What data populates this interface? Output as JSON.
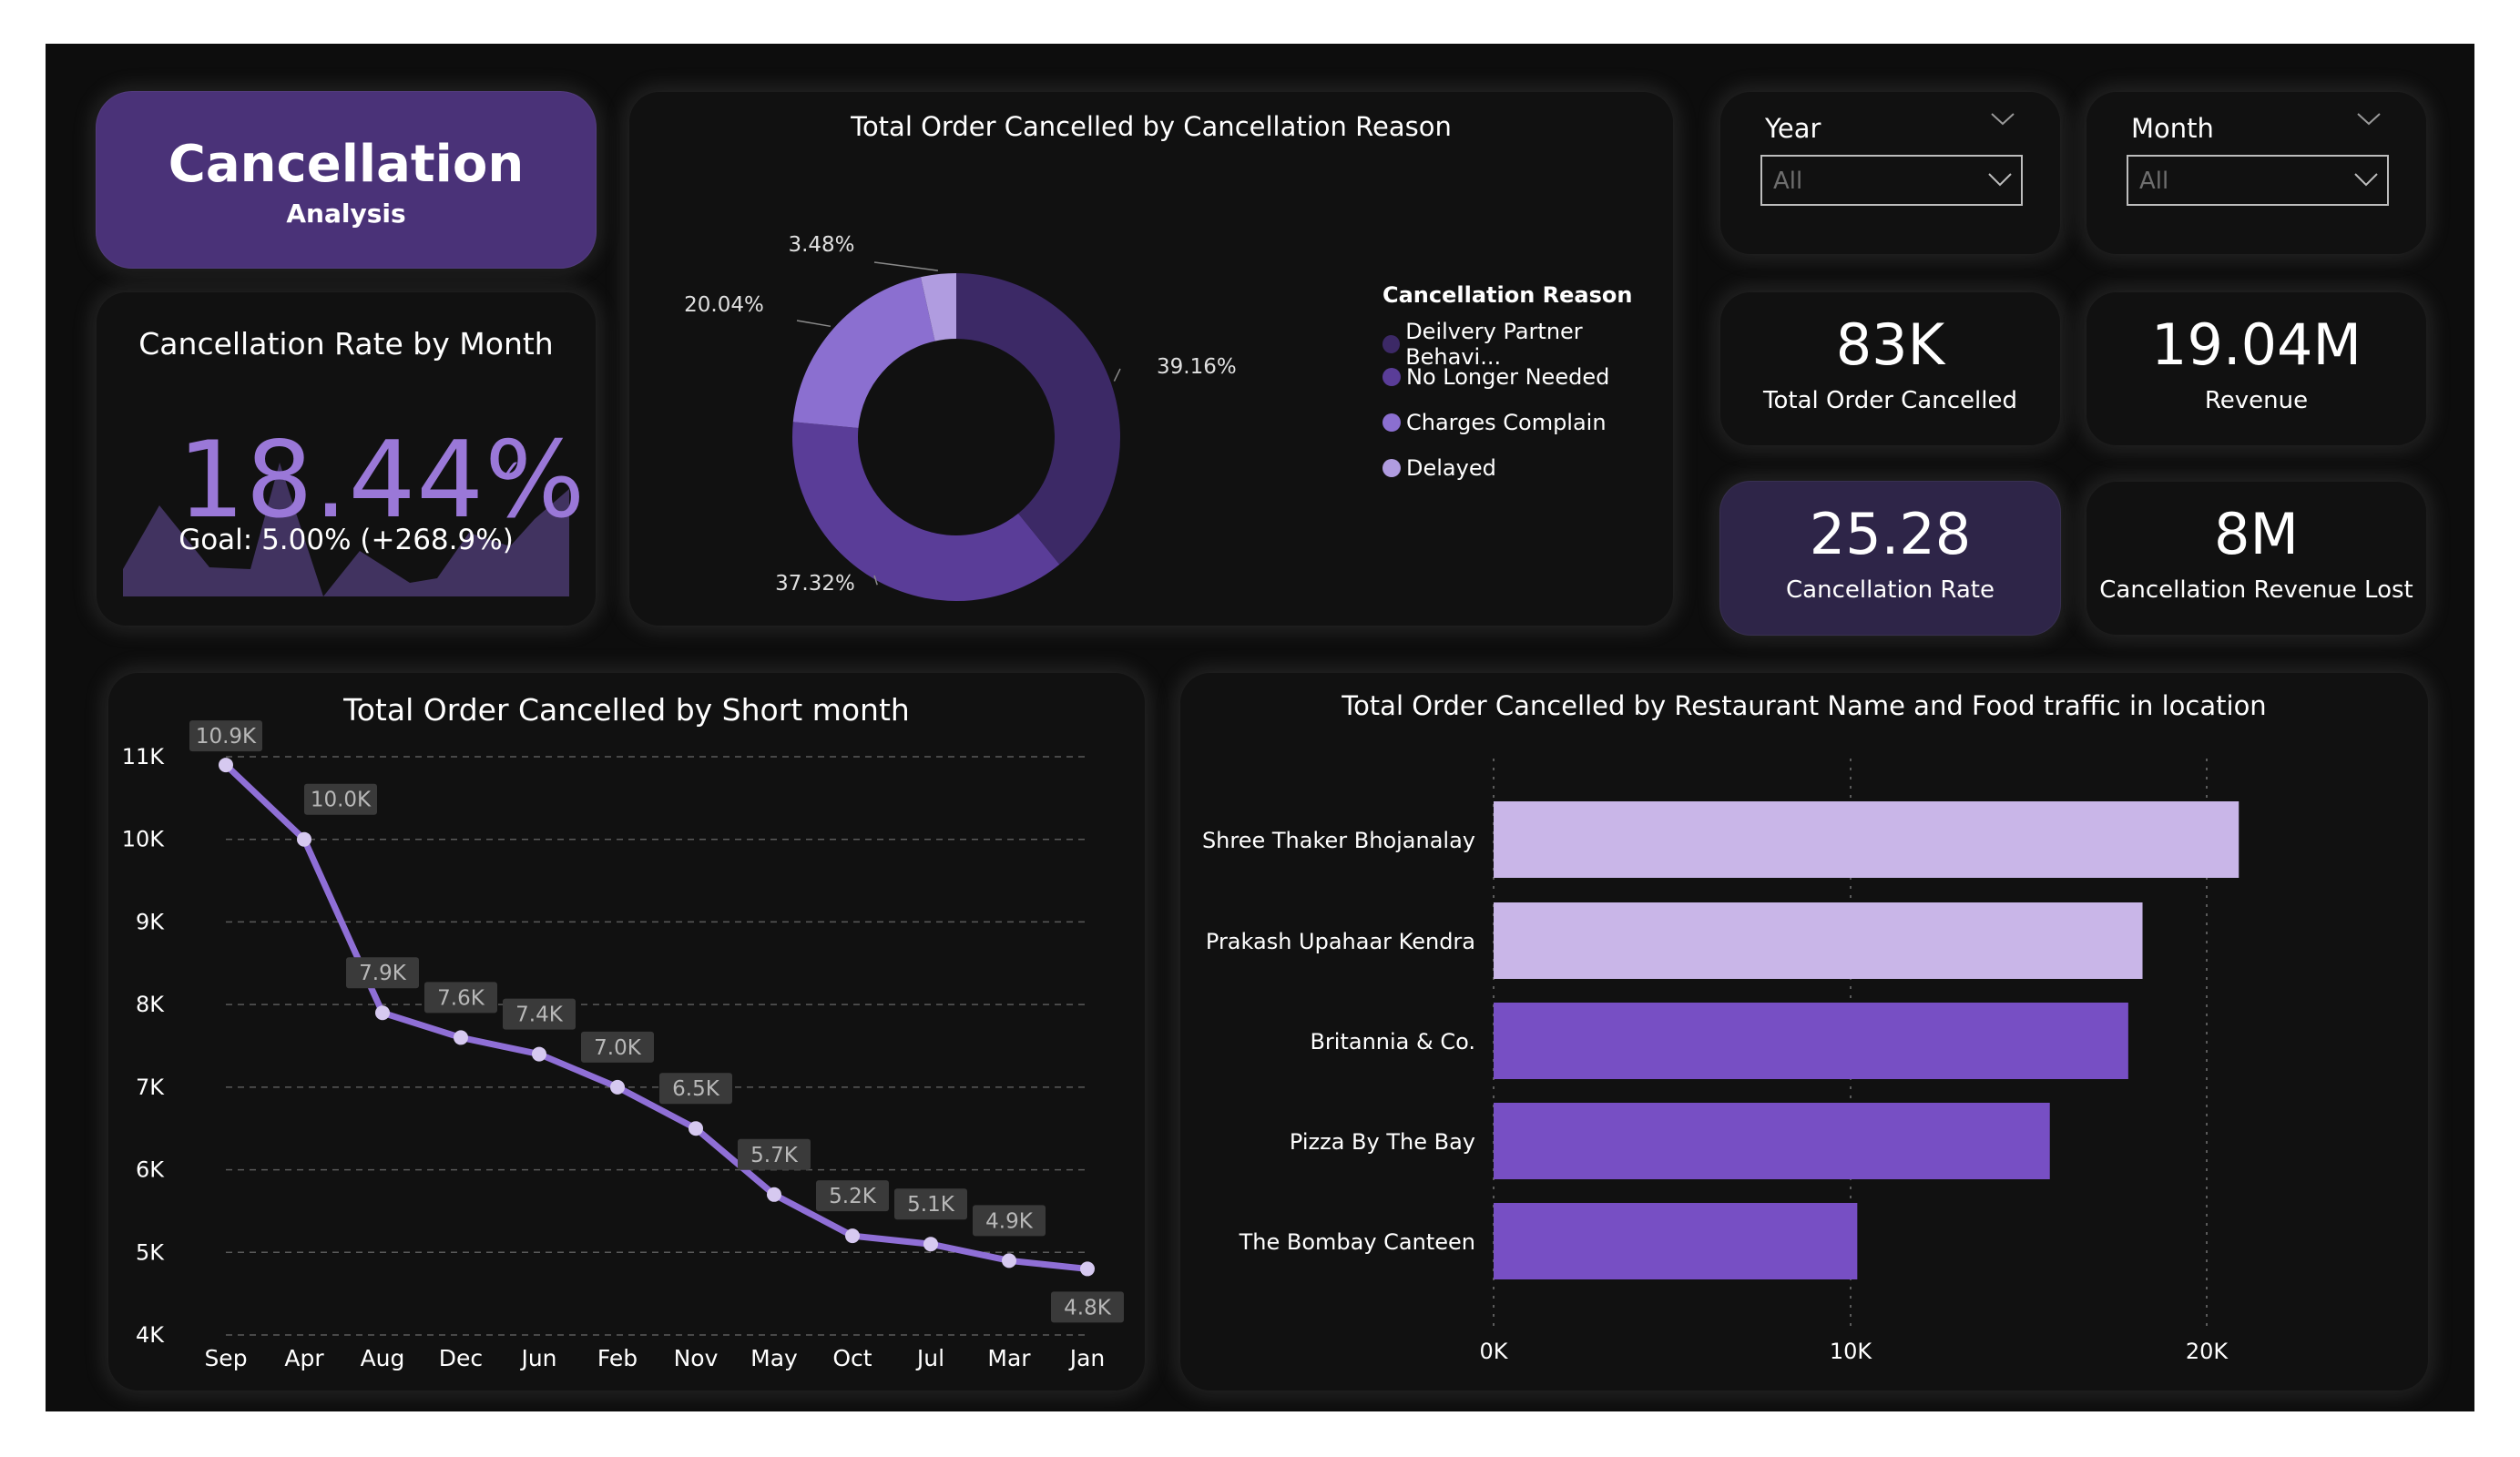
{
  "header": {
    "title": "Cancellation",
    "subtitle": "Analysis"
  },
  "rate_card": {
    "title": "Cancellation Rate by Month",
    "value": "18.44%",
    "goal": "Goal: 5.00% (+268.9%)"
  },
  "slicers": {
    "year": {
      "label": "Year",
      "value": "All"
    },
    "month": {
      "label": "Month",
      "value": "All"
    }
  },
  "kpis": {
    "total_orders": {
      "value": "83K",
      "label": "Total Order Cancelled"
    },
    "revenue": {
      "value": "19.04M",
      "label": "Revenue"
    },
    "cancellation_rate": {
      "value": "25.28",
      "label": "Cancellation Rate"
    },
    "revenue_lost": {
      "value": "8M",
      "label": "Cancellation Revenue Lost"
    }
  },
  "colors": {
    "accent": "#8b6fd0",
    "title_card": "#4a3278",
    "donut": [
      "#3c2966",
      "#5a3d98",
      "#8b6fd0",
      "#b09ce0"
    ],
    "bar_light": "#c9b6e8",
    "bar_dark": "#774fc4"
  },
  "chart_data": [
    {
      "type": "pie",
      "title": "Total Order Cancelled by Cancellation Reason",
      "legend_title": "Cancellation Reason",
      "legend_position": "right",
      "categories": [
        "Deilvery Partner Behavi...",
        "No Longer Needed",
        "Charges Complain",
        "Delayed"
      ],
      "values": [
        39.16,
        37.32,
        20.04,
        3.48
      ],
      "labels": [
        "39.16%",
        "37.32%",
        "20.04%",
        "3.48%"
      ]
    },
    {
      "type": "line",
      "title": "Total Order Cancelled by Short month",
      "categories": [
        "Sep",
        "Apr",
        "Aug",
        "Dec",
        "Jun",
        "Feb",
        "Nov",
        "May",
        "Oct",
        "Jul",
        "Mar",
        "Jan"
      ],
      "values": [
        10.9,
        10.0,
        7.9,
        7.6,
        7.4,
        7.0,
        6.5,
        5.7,
        5.2,
        5.1,
        4.9,
        4.8
      ],
      "data_labels": [
        "10.9K",
        "10.0K",
        "7.9K",
        "7.6K",
        "7.4K",
        "7.0K",
        "6.5K",
        "5.7K",
        "5.2K",
        "5.1K",
        "4.9K",
        "4.8K"
      ],
      "ylim": [
        4,
        11
      ],
      "yticks": [
        "4K",
        "5K",
        "6K",
        "7K",
        "8K",
        "9K",
        "10K",
        "11K"
      ],
      "grid": true
    },
    {
      "type": "bar",
      "orientation": "horizontal",
      "title": "Total Order Cancelled by Restaurant Name and Food traffic in location",
      "categories": [
        "Shree Thaker Bhojanalay",
        "Prakash Upahaar Kendra",
        "Britannia & Co.",
        "Pizza By The Bay",
        "The Bombay Canteen"
      ],
      "values": [
        20900,
        18200,
        17800,
        15600,
        10200
      ],
      "bar_shades": [
        "light",
        "light",
        "dark",
        "dark",
        "dark"
      ],
      "xlim": [
        0,
        20000
      ],
      "xticks": [
        "0K",
        "10K",
        "20K"
      ],
      "grid": true
    }
  ]
}
